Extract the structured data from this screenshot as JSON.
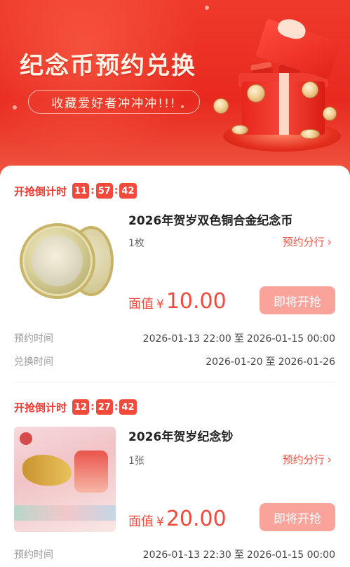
{
  "banner": {
    "title": "纪念币预约兑换",
    "subtitle": "收藏爱好者冲冲冲!!!"
  },
  "countdown_label": "开抢倒计时",
  "items": [
    {
      "countdown": [
        "11",
        "57",
        "42"
      ],
      "title": "2026年贺岁双色铜合金纪念币",
      "qty": "1枚",
      "share_label": "预约分行",
      "price_label": "面值",
      "currency": "¥",
      "price": "10.00",
      "button": "即将开抢",
      "reserve_label": "预约时间",
      "reserve_start": "2026-01-13 22:00",
      "reserve_end": "2026-01-15 00:00",
      "exchange_label": "兑换时间",
      "exchange_start": "2026-01-20",
      "exchange_end": "2026-01-26",
      "to": "至"
    },
    {
      "countdown": [
        "12",
        "27",
        "42"
      ],
      "title": "2026年贺岁纪念钞",
      "qty": "1张",
      "share_label": "预约分行",
      "price_label": "面值",
      "currency": "¥",
      "price": "20.00",
      "button": "即将开抢",
      "reserve_label": "预约时间",
      "reserve_start": "2026-01-13 22:30",
      "reserve_end": "2026-01-15 00:00",
      "to": "至"
    }
  ],
  "colors": {
    "accent": "#f04a3c",
    "button_disabled": "#f9a39b",
    "banner": "#e8291f"
  }
}
